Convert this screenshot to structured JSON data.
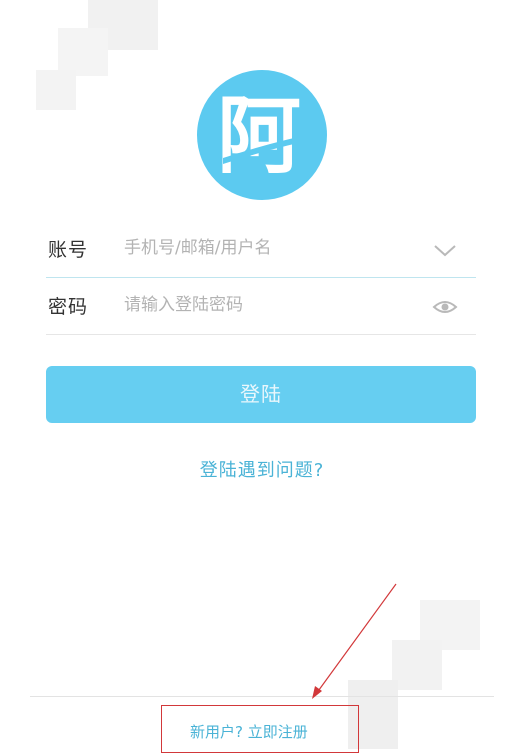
{
  "logo": {
    "glyph": "阿"
  },
  "form": {
    "account": {
      "label": "账号",
      "placeholder": "手机号/邮箱/用户名"
    },
    "password": {
      "label": "密码",
      "placeholder": "请输入登陆密码"
    }
  },
  "login_button": {
    "label": "登陆"
  },
  "help_link": {
    "label": "登陆遇到问题?"
  },
  "register_link": {
    "label": "新用户? 立即注册"
  },
  "colors": {
    "brand": "#5ccaf0",
    "button": "#66cef1",
    "link": "#4ab3d6",
    "annotation": "#d2383a"
  }
}
